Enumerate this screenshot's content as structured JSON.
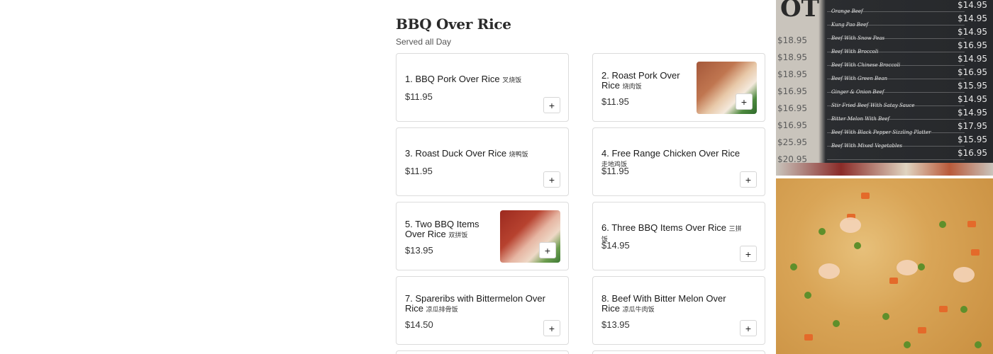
{
  "section": {
    "title": "BBQ Over Rice",
    "subtitle": "Served all Day"
  },
  "add_symbol": "+",
  "items": [
    {
      "name": "1. BBQ Pork Over Rice",
      "zh": "叉烧饭",
      "price": "$11.95",
      "has_image": false
    },
    {
      "name": "2. Roast Pork Over Rice",
      "zh": "烧肉饭",
      "price": "$11.95",
      "has_image": true
    },
    {
      "name": "3. Roast Duck Over Rice",
      "zh": "烧鸭饭",
      "price": "$11.95",
      "has_image": false
    },
    {
      "name": "4. Free Range Chicken Over Rice",
      "zh": "走地鸡饭",
      "price": "$11.95",
      "has_image": false
    },
    {
      "name": "5. Two BBQ Items Over Rice",
      "zh": "双拼饭",
      "price": "$13.95",
      "has_image": true
    },
    {
      "name": "6. Three BBQ Items Over Rice",
      "zh": "三拼饭",
      "price": "$14.95",
      "has_image": false
    },
    {
      "name": "7. Spareribs with Bittermelon Over Rice",
      "zh": "凉瓜排骨饭",
      "price": "$14.50",
      "has_image": false
    },
    {
      "name": "8. Beef With Bitter Melon Over Rice",
      "zh": "凉瓜牛肉饭",
      "price": "$13.95",
      "has_image": false
    }
  ],
  "side_photos": {
    "menu_board": {
      "heading_fragment": "OT",
      "left_prices": [
        "$18.95",
        "$18.95",
        "$18.95",
        "$16.95",
        "$16.95",
        "$16.95",
        "$25.95",
        "$20.95"
      ],
      "dishes": [
        "Orange Beef",
        "Kung Pao Beef",
        "Beef With Snow Peas",
        "Beef With Broccoli",
        "Beef With Chinese Broccoli",
        "Beef With Green Bean",
        "Ginger & Onion Beef",
        "Stir Fried Beef With Satay Sauce",
        "Bitter Melon With Beef",
        "Beef With Black Pepper Sizzling Platter",
        "Beef With Mixed Vegetables"
      ],
      "prices": [
        "$14.95",
        "$14.95",
        "$14.95",
        "$16.95",
        "$14.95",
        "$16.95",
        "$15.95",
        "$14.95",
        "$14.95",
        "$17.95",
        "$15.95",
        "$16.95"
      ]
    },
    "fried_rice": {}
  }
}
